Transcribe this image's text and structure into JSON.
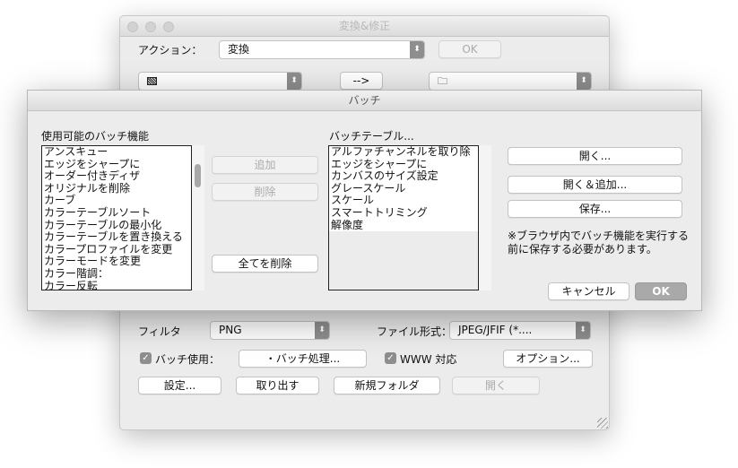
{
  "main_window": {
    "title": "変換&修正",
    "action_label": "アクション：",
    "action_value": "変換",
    "ok": "OK",
    "arrow_button": "-->",
    "source_icon": "image-icon",
    "dest_icon": "folder-icon",
    "filter_label": "フィルタ",
    "filter_value": "PNG",
    "format_label": "ファイル形式：",
    "format_value": "JPEG/JFIF (*....",
    "use_batch_label": "バッチ使用：",
    "use_batch_checked": true,
    "batch_process": "・バッチ処理...",
    "www_label": "WWW 対応",
    "www_checked": true,
    "options": "オプション...",
    "settings": "設定...",
    "extract": "取り出す",
    "new_folder": "新規フォルダ",
    "open": "開く"
  },
  "batch_dialog": {
    "title": "バッチ",
    "available_label": "使用可能のバッチ機能",
    "available": [
      "アンスキュー",
      "エッジをシャープに",
      "オーダー付きディザ",
      "オリジナルを削除",
      "カーブ",
      "カラーテーブルソート",
      "カラーテーブルの最小化",
      "カラーテーブルを置き換える",
      "カラープロファイルを変更",
      "カラーモードを変更",
      "カラー階調：",
      "カラー反転"
    ],
    "add": "追加",
    "remove": "削除",
    "remove_all": "全てを削除",
    "table_label": "バッチテーブル...",
    "table": [
      "アルファチャンネルを取り除",
      "エッジをシャープに",
      "カンバスのサイズ設定",
      "グレースケール",
      "スケール",
      "スマートトリミング",
      "解像度"
    ],
    "open": "開く...",
    "open_add": "開く＆追加...",
    "save": "保存...",
    "note": "※ブラウザ内でバッチ機能を実行する前に保存する必要があります。",
    "cancel": "キャンセル",
    "ok": "OK"
  }
}
